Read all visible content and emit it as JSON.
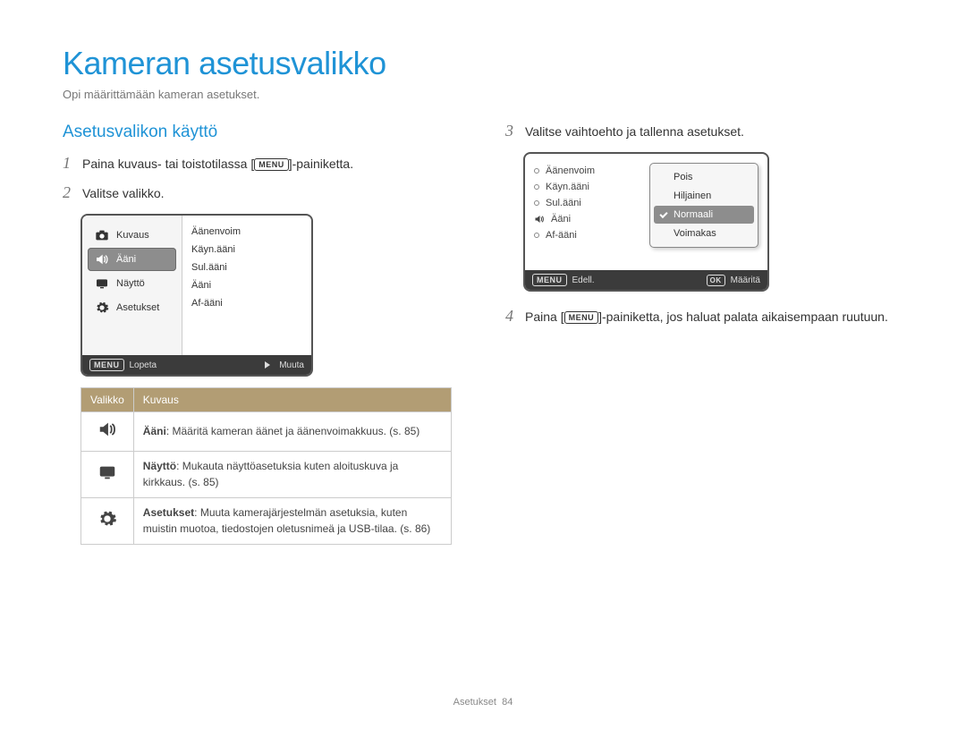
{
  "page": {
    "title": "Kameran asetusvalikko",
    "subtitle": "Opi määrittämään kameran asetukset.",
    "footer_section": "Asetukset",
    "footer_page": "84"
  },
  "left": {
    "heading": "Asetusvalikon käyttö",
    "step1_pre": "Paina kuvaus- tai toistotilassa [",
    "step1_post": "]-painiketta.",
    "step2": "Valitse valikko.",
    "num1": "1",
    "num2": "2"
  },
  "screenshot1": {
    "left_items": [
      {
        "icon": "camera-icon",
        "label": "Kuvaus",
        "selected": false
      },
      {
        "icon": "sound-icon",
        "label": "Ääni",
        "selected": true
      },
      {
        "icon": "display-icon",
        "label": "Näyttö",
        "selected": false
      },
      {
        "icon": "gear-icon",
        "label": "Asetukset",
        "selected": false
      }
    ],
    "right_items": [
      "Äänenvoim",
      "Käyn.ääni",
      "Sul.ääni",
      "Ääni",
      "Af-ääni"
    ],
    "footer_left_label": "Lopeta",
    "footer_right_label": "Muuta",
    "menu_label": "MENU"
  },
  "menu_table": {
    "headers": {
      "a": "Valikko",
      "b": "Kuvaus"
    },
    "rows": [
      {
        "icon": "sound-icon",
        "bold": "Ääni",
        "text": ": Määritä kameran äänet ja äänenvoimakkuus. (s. 85)"
      },
      {
        "icon": "display-icon",
        "bold": "Näyttö",
        "text": ": Mukauta näyttöasetuksia kuten aloituskuva ja kirkkaus. (s. 85)"
      },
      {
        "icon": "gear-icon",
        "bold": "Asetukset",
        "text": ": Muuta kamerajärjestelmän asetuksia, kuten muistin muotoa, tiedostojen oletusnimeä ja USB-tilaa. (s. 86)"
      }
    ]
  },
  "right": {
    "step3": "Valitse vaihtoehto ja tallenna asetukset.",
    "step4_pre": "Paina [",
    "step4_post": "]-painiketta, jos haluat palata aikaisempaan ruutuun.",
    "num3": "3",
    "num4": "4"
  },
  "screenshot2": {
    "left_items": [
      {
        "marker": "bullet",
        "label": "Äänenvoim"
      },
      {
        "marker": "bullet",
        "label": "Käyn.ääni"
      },
      {
        "marker": "bullet",
        "label": "Sul.ääni"
      },
      {
        "marker": "sound-icon",
        "label": "Ääni"
      },
      {
        "marker": "bullet",
        "label": "Af-ääni"
      }
    ],
    "options": [
      {
        "label": "Pois",
        "selected": false,
        "checked": false
      },
      {
        "label": "Hiljainen",
        "selected": false,
        "checked": false
      },
      {
        "label": "Normaali",
        "selected": true,
        "checked": true
      },
      {
        "label": "Voimakas",
        "selected": false,
        "checked": false
      }
    ],
    "footer_left_label": "Edell.",
    "footer_right_label": "Määritä",
    "menu_label": "MENU",
    "ok_label": "OK"
  }
}
